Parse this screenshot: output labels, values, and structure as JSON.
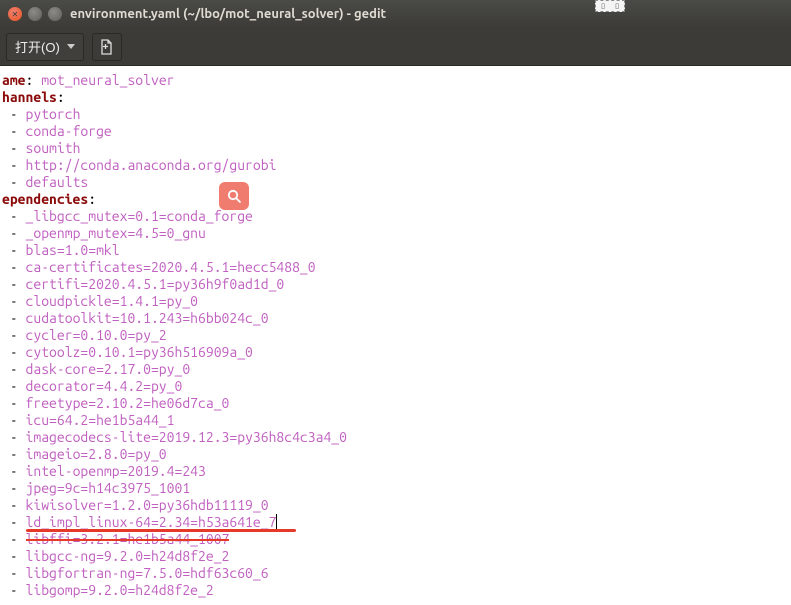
{
  "window": {
    "title": "environment.yaml (~/lbo/mot_neural_solver) - gedit"
  },
  "toolbar": {
    "open_label": "打开(O)"
  },
  "yaml": {
    "name_key": "ame",
    "name_val": "mot_neural_solver",
    "channels_key": "hannels",
    "channels": [
      "pytorch",
      "conda-forge",
      "soumith",
      "http://conda.anaconda.org/gurobi",
      "defaults"
    ],
    "deps_key": "ependencies",
    "deps": [
      "_libgcc_mutex=0.1=conda_forge",
      "_openmp_mutex=4.5=0_gnu",
      "blas=1.0=mkl",
      "ca-certificates=2020.4.5.1=hecc5488_0",
      "certifi=2020.4.5.1=py36h9f0ad1d_0",
      "cloudpickle=1.4.1=py_0",
      "cudatoolkit=10.1.243=h6bb024c_0",
      "cycler=0.10.0=py_2",
      "cytoolz=0.10.1=py36h516909a_0",
      "dask-core=2.17.0=py_0",
      "decorator=4.4.2=py_0",
      "freetype=2.10.2=he06d7ca_0",
      "icu=64.2=he1b5a44_1",
      "imagecodecs-lite=2019.12.3=py36h8c4c3a4_0",
      "imageio=2.8.0=py_0",
      "intel-openmp=2019.4=243",
      "jpeg=9c=h14c3975_1001",
      "kiwisolver=1.2.0=py36hdb11119_0",
      "ld_impl_linux-64=2.34=h53a641e_7",
      "libffi=3.2.1=he1b5a44_1007",
      "libgcc-ng=9.2.0=h24d8f2e_2",
      "libgfortran-ng=7.5.0=hdf63c60_6",
      "libgomp=9.2.0=h24d8f2e_2"
    ]
  }
}
